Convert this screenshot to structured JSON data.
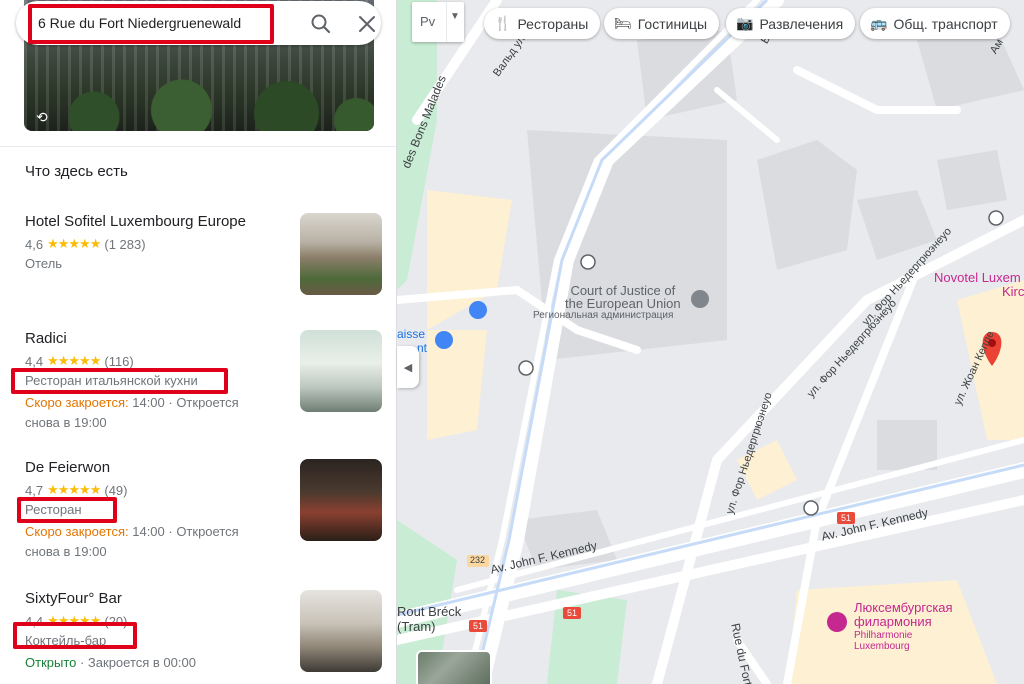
{
  "search": {
    "value": "6 Rue du Fort Niedergruenewald"
  },
  "sidebar": {
    "section_title": "Что здесь есть",
    "places": [
      {
        "name": "Hotel Sofitel Luxembourg Europe",
        "rating": "4,6",
        "stars": "★★★★★",
        "count": "(1 283)",
        "type": "Отель",
        "hours_warn": "",
        "hours_rest": ""
      },
      {
        "name": "Radici",
        "rating": "4,4",
        "stars": "★★★★★",
        "count": "(116)",
        "type": "Ресторан итальянской кухни",
        "hours_warn": "Скоро закроется:",
        "hours_rest": " 14:00 · Откроется снова в 19:00"
      },
      {
        "name": "De Feierwon",
        "rating": "4,7",
        "stars": "★★★★★",
        "count": "(49)",
        "type": "Ресторан",
        "hours_warn": "Скоро закроется:",
        "hours_rest": " 14:00 · Откроется снова в 19:00"
      },
      {
        "name": "SixtyFour° Bar",
        "rating": "4,4",
        "stars": "★★★★★",
        "count": "(20)",
        "type": "Коктейль-бар",
        "hours_open": "Открыто",
        "hours_rest": " · Закроется в 00:00"
      }
    ]
  },
  "map": {
    "layer_label": "Рv",
    "chips": [
      "Рестораны",
      "Гостиницы",
      "Развлечения",
      "Общ. транспорт"
    ],
    "labels": {
      "court": "Court of Justice of\nthe European Union",
      "court_sub": "Региональная администрация",
      "novotel": "Novotel Luxem",
      "novotel2": "Kirc",
      "philharmonie_ru": "Люксембургская\nфилармония",
      "philharmonie": "Philharmonie\nLuxembourg",
      "kennedy1": "Av. John F. Kennedy",
      "kennedy2": "Av. John F. Kennedy",
      "rout_breck": "Rout Bréck\n(Tram)",
      "rue_fort": "Rue du Fort",
      "bons_malades": "des Bons Malades",
      "val": "Вальд ул.",
      "ul_fort1": "ул. Фор Ньедергрюэнеуо",
      "ul_fort2": "ул. Фор Ньедергрюэнеуо",
      "ul_fort3": "ул. Фор Ньедергрюэнеуо",
      "jean": "ул. Жоан Кепле",
      "ed": "Бу",
      "am": "Ам",
      "aisse": "aisse",
      "nt": "nt",
      "b232": "232",
      "b51a": "51",
      "b51b": "51",
      "b51c": "51"
    }
  },
  "colors": {
    "red_highlight": "#e0001a",
    "star": "#fbbc04",
    "warn": "#e37400",
    "open": "#188038",
    "poi_pink": "#c5288e",
    "pin": "#ea4335"
  }
}
